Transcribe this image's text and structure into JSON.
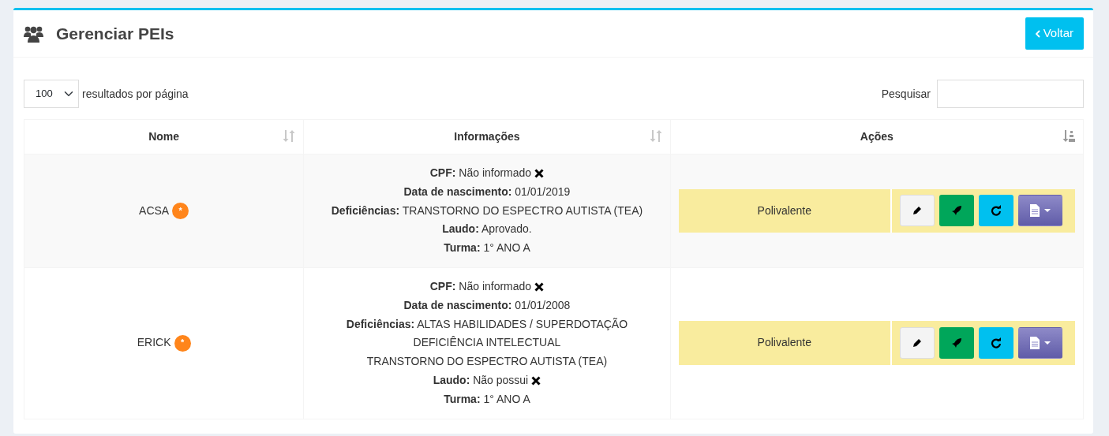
{
  "page_title": "Gerenciar PEIs",
  "back_button": "Voltar",
  "page_length": {
    "value": "100",
    "label": "resultados por página"
  },
  "search": {
    "label": "Pesquisar"
  },
  "columns": [
    {
      "label": "Nome",
      "kind": "sortable"
    },
    {
      "label": "Informações",
      "kind": "sortable"
    },
    {
      "label": "Ações",
      "kind": "sorted"
    }
  ],
  "rows": [
    {
      "name": "ACSA",
      "badge": "*",
      "info": [
        {
          "text": "**CPF:** Não informado",
          "missing": true
        },
        {
          "text": "**Data de nascimento:** 01/01/2019",
          "missing": false
        },
        {
          "text": "**Deficiências:** TRANSTORNO DO ESPECTRO AUTISTA (TEA)",
          "missing": false
        },
        {
          "text": "**Laudo:** Aprovado.",
          "missing": false
        },
        {
          "text": "**Turma:** 1° ANO A",
          "missing": false
        }
      ],
      "teacher": "Polivalente"
    },
    {
      "name": "ERICK",
      "badge": "*",
      "info": [
        {
          "text": "**CPF:** Não informado",
          "missing": true
        },
        {
          "text": "**Data de nascimento:** 01/01/2008",
          "missing": false
        },
        {
          "text": "**Deficiências:** ALTAS HABILIDADES / SUPERDOTAÇÃO",
          "missing": false
        },
        {
          "text": "DEFICIÊNCIA INTELECTUAL",
          "missing": false
        },
        {
          "text": "TRANSTORNO DO ESPECTRO AUTISTA (TEA)",
          "missing": false
        },
        {
          "text": "**Laudo:** Não possui",
          "missing": true
        },
        {
          "text": "**Turma:** 1° ANO A",
          "missing": false
        }
      ],
      "teacher": "Polivalente"
    }
  ]
}
